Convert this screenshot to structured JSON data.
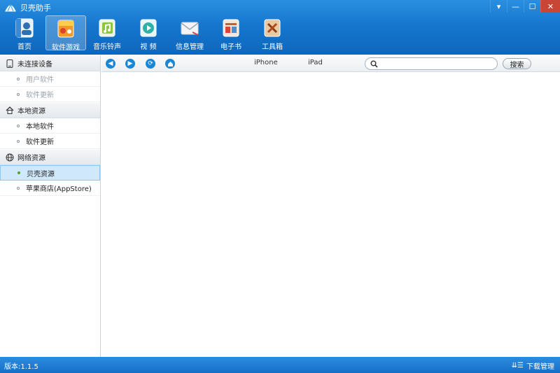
{
  "app": {
    "title": "贝壳助手"
  },
  "window_controls": [
    {
      "name": "menu-button",
      "glyph": "▾"
    },
    {
      "name": "minimize-button",
      "glyph": "—"
    },
    {
      "name": "maximize-button",
      "glyph": "☐"
    },
    {
      "name": "close-button",
      "glyph": "✕"
    }
  ],
  "nav": [
    {
      "label": "首页",
      "icon": "home-icon",
      "active": false
    },
    {
      "label": "软件游戏",
      "icon": "apps-games-icon",
      "active": true
    },
    {
      "label": "音乐铃声",
      "icon": "music-icon",
      "active": false
    },
    {
      "label": "视  频",
      "icon": "video-icon",
      "active": false
    },
    {
      "label": "信息管理",
      "icon": "message-icon",
      "active": false
    },
    {
      "label": "电子书",
      "icon": "ebook-icon",
      "active": false
    },
    {
      "label": "工具箱",
      "icon": "toolbox-icon",
      "active": false
    }
  ],
  "sidebar": {
    "sections": [
      {
        "title": "未连接设备",
        "icon": "device-icon",
        "items": [
          {
            "label": "用户软件",
            "state": "disabled"
          },
          {
            "label": "软件更新",
            "state": "disabled"
          }
        ]
      },
      {
        "title": "本地资源",
        "icon": "house-icon",
        "items": [
          {
            "label": "本地软件",
            "state": "normal"
          },
          {
            "label": "软件更新",
            "state": "normal"
          }
        ]
      },
      {
        "title": "网络资源",
        "icon": "globe-icon",
        "items": [
          {
            "label": "贝壳资源",
            "state": "active"
          },
          {
            "label": "苹果商店(AppStore)",
            "state": "normal"
          }
        ]
      }
    ]
  },
  "toolbar": {
    "tabs": [
      "iPhone",
      "iPad"
    ],
    "search": {
      "value": "",
      "placeholder": ""
    },
    "search_button": "搜索"
  },
  "status": {
    "version": "版本:1.1.5",
    "download": "下载管理"
  },
  "colors": {
    "accent": "#1677cf",
    "active_item": "#cfe8fb",
    "active_dot": "#59b520"
  }
}
